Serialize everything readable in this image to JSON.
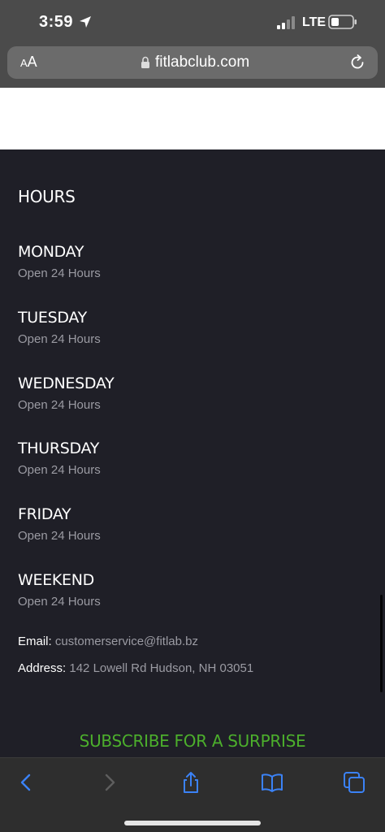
{
  "status_bar": {
    "time": "3:59",
    "network": "LTE",
    "icons": [
      "location-arrow-icon",
      "signal-icon",
      "battery-icon"
    ]
  },
  "browser": {
    "text_size_label_small": "A",
    "text_size_label_large": "A",
    "url": "fitlabclub.com",
    "icons": [
      "lock-icon",
      "reload-icon"
    ]
  },
  "hours": {
    "title": "HOURS",
    "days": [
      {
        "name": "MONDAY",
        "hours": "Open 24 Hours"
      },
      {
        "name": "TUESDAY",
        "hours": "Open 24 Hours"
      },
      {
        "name": "WEDNESDAY",
        "hours": "Open 24 Hours"
      },
      {
        "name": "THURSDAY",
        "hours": "Open 24 Hours"
      },
      {
        "name": "FRIDAY",
        "hours": "Open 24 Hours"
      },
      {
        "name": "WEEKEND",
        "hours": "Open 24 Hours"
      }
    ]
  },
  "contact": {
    "email_label": "Email:",
    "email_value": "customerservice@fitlab.bz",
    "address_label": "Address:",
    "address_value": "142 Lowell Rd Hudson, NH 03051"
  },
  "subscribe": {
    "text": "SUBSCRIBE FOR A SURPRISE"
  },
  "colors": {
    "background": "#1f1f27",
    "accent_green": "#4caf2c",
    "muted_text": "#9b9ba3",
    "ios_blue": "#3b82f6"
  },
  "toolbar": {
    "icons": [
      "back-icon",
      "forward-icon",
      "share-icon",
      "bookmarks-icon",
      "tabs-icon"
    ]
  }
}
